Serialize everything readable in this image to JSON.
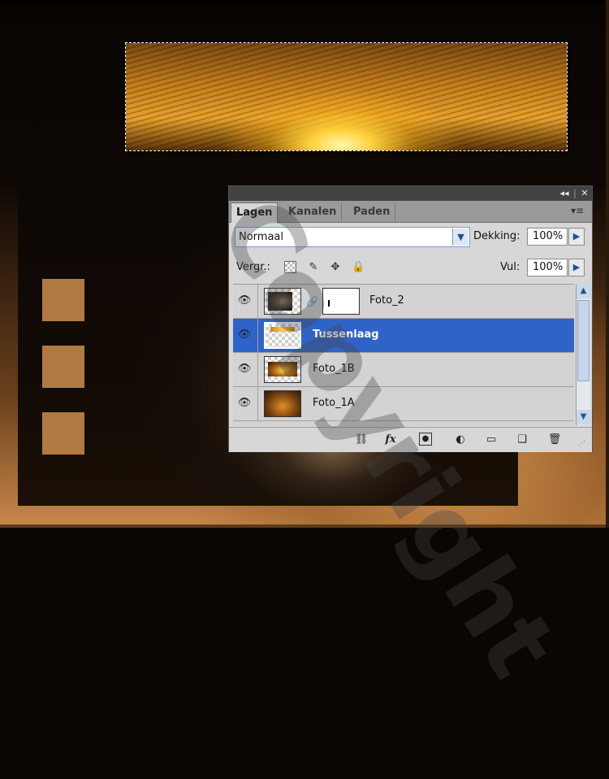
{
  "canvas": {
    "watermark_text": "Copyright"
  },
  "panel": {
    "collapse_label": "◂◂",
    "close_label": "✕",
    "menu_icon": "panel-menu-icon",
    "tabs": [
      {
        "label": "Lagen",
        "active": true
      },
      {
        "label": "Kanalen",
        "active": false
      },
      {
        "label": "Paden",
        "active": false
      }
    ],
    "blend_mode": "Normaal",
    "opacity_label": "Dekking:",
    "opacity_value": "100%",
    "lock_label": "Vergr.:",
    "fill_label": "Vul:",
    "fill_value": "100%",
    "layers": [
      {
        "name": "Foto_2",
        "visible": true,
        "selected": false,
        "has_mask": true
      },
      {
        "name": "Tussenlaag",
        "visible": true,
        "selected": true,
        "has_mask": false
      },
      {
        "name": "Foto_1B",
        "visible": true,
        "selected": false,
        "has_mask": false
      },
      {
        "name": "Foto_1A",
        "visible": true,
        "selected": false,
        "has_mask": false
      }
    ],
    "bottom_icons": [
      "link-layers-icon",
      "fx-icon",
      "add-mask-icon",
      "adjustment-layer-icon",
      "new-group-icon",
      "new-layer-icon",
      "trash-icon"
    ],
    "fx_label": "fx",
    "accent_color": "#2f63c7"
  }
}
